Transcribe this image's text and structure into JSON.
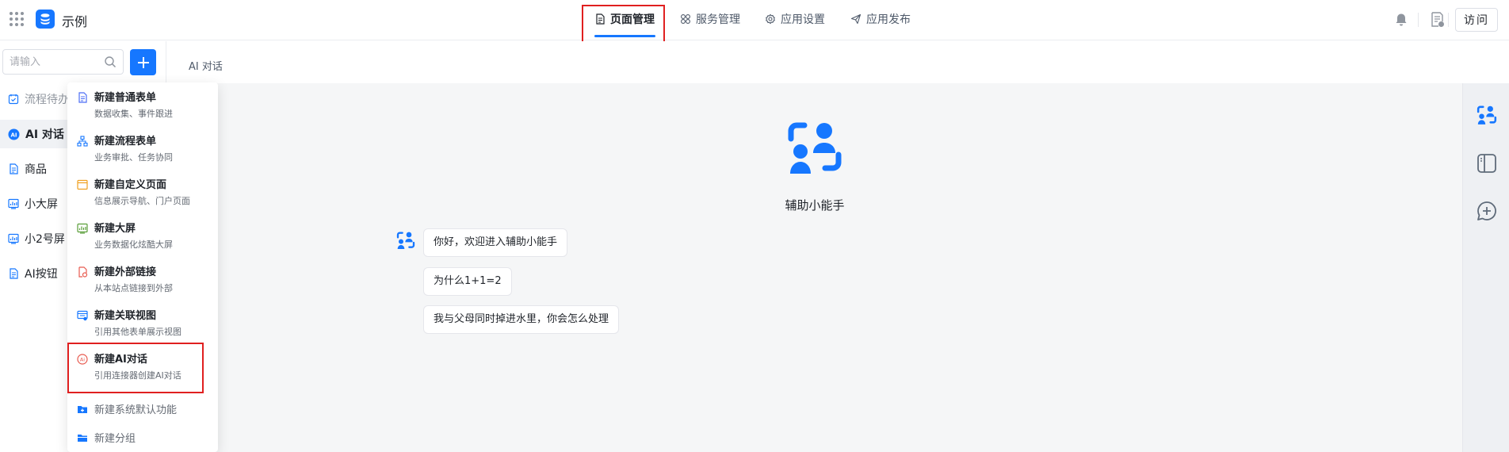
{
  "app": {
    "name": "示例"
  },
  "nav": {
    "tabs": [
      {
        "label": "页面管理",
        "icon": "page-icon"
      },
      {
        "label": "服务管理",
        "icon": "services-icon"
      },
      {
        "label": "应用设置",
        "icon": "settings-gear-icon"
      },
      {
        "label": "应用发布",
        "icon": "publish-plane-icon"
      }
    ],
    "active_tab": "页面管理"
  },
  "header_actions": {
    "visit_label": "访问"
  },
  "sidebar": {
    "search_placeholder": "请输入",
    "items": [
      {
        "label": "流程待办",
        "icon": "checklist-icon"
      },
      {
        "label": "AI 对话",
        "icon": "ai-icon"
      },
      {
        "label": "商品",
        "icon": "document-icon"
      },
      {
        "label": "小大屏",
        "icon": "dashboard-icon"
      },
      {
        "label": "小2号屏",
        "icon": "dashboard-icon"
      },
      {
        "label": "AI按钮",
        "icon": "document-icon"
      }
    ]
  },
  "menu": {
    "items": [
      {
        "title": "新建普通表单",
        "desc": "数据收集、事件跟进",
        "icon": "form-icon"
      },
      {
        "title": "新建流程表单",
        "desc": "业务审批、任务协同",
        "icon": "flow-icon"
      },
      {
        "title": "新建自定义页面",
        "desc": "信息展示导航、门户页面",
        "icon": "custom-page-icon"
      },
      {
        "title": "新建大屏",
        "desc": "业务数据化炫酷大屏",
        "icon": "big-screen-icon"
      },
      {
        "title": "新建外部链接",
        "desc": "从本站点链接到外部",
        "icon": "external-link-icon"
      },
      {
        "title": "新建关联视图",
        "desc": "引用其他表单展示视图",
        "icon": "linked-view-icon"
      },
      {
        "title": "新建AI对话",
        "desc": "引用连接器创建AI对话",
        "icon": "ai-chat-icon"
      }
    ],
    "plain_items": [
      {
        "title": "新建系统默认功能",
        "icon": "folder-plus-icon"
      },
      {
        "title": "新建分组",
        "icon": "folder-icon"
      }
    ]
  },
  "content": {
    "breadcrumb": "AI 对话",
    "assistant_name": "辅助小能手",
    "messages": [
      "你好，欢迎进入辅助小能手",
      "为什么1+1=2",
      "我与父母同时掉进水里，你会怎么处理"
    ]
  },
  "colors": {
    "accent": "#1677ff",
    "highlight_box": "#e02020"
  }
}
